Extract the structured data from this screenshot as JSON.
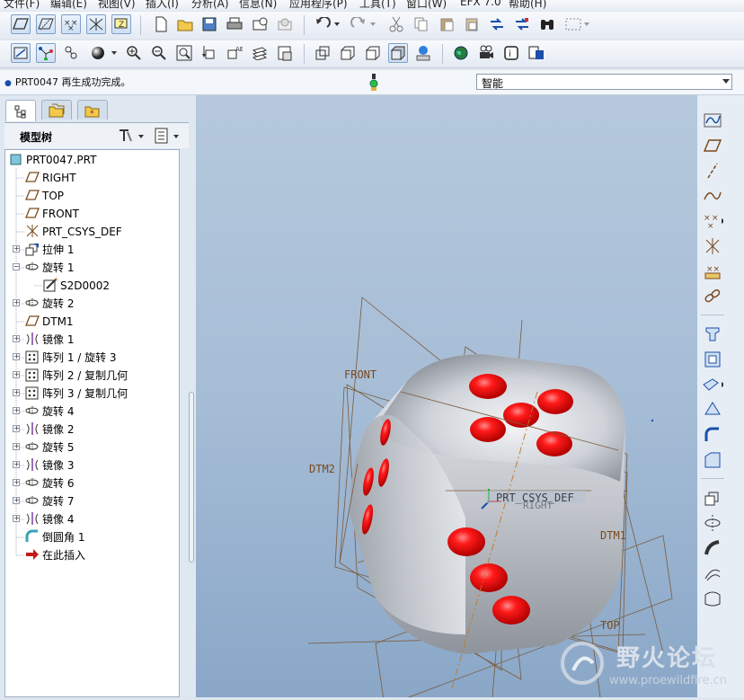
{
  "menu": [
    "文件(F)",
    "编辑(E)",
    "视图(V)",
    "插入(I)",
    "分析(A)",
    "信息(N)",
    "应用程序(P)",
    "工具(T)",
    "窗口(W)",
    "EFX 7.0",
    "帮助(H)"
  ],
  "status": {
    "message": "PRT0047 再生成功完成。",
    "filter_value": "智能"
  },
  "model_tree": {
    "title": "模型树",
    "items": [
      {
        "label": "PRT0047.PRT",
        "icon": "part-icon",
        "level": 0,
        "expander": "",
        "color": "#000"
      },
      {
        "label": "RIGHT",
        "icon": "datum-plane-icon",
        "level": 1,
        "expander": "",
        "color": "#000"
      },
      {
        "label": "TOP",
        "icon": "datum-plane-icon",
        "level": 1,
        "expander": "",
        "color": "#000"
      },
      {
        "label": "FRONT",
        "icon": "datum-plane-icon",
        "level": 1,
        "expander": "",
        "color": "#000"
      },
      {
        "label": "PRT_CSYS_DEF",
        "icon": "csys-icon",
        "level": 1,
        "expander": "",
        "color": "#000"
      },
      {
        "label": "拉伸 1",
        "icon": "extrude-icon",
        "level": 1,
        "expander": "+",
        "color": "#000"
      },
      {
        "label": "旋转 1",
        "icon": "revolve-icon",
        "level": 1,
        "expander": "−",
        "color": "#000"
      },
      {
        "label": "S2D0002",
        "icon": "sketch-icon",
        "level": 2,
        "expander": "",
        "color": "#000"
      },
      {
        "label": "旋转 2",
        "icon": "revolve-icon",
        "level": 1,
        "expander": "+",
        "color": "#000"
      },
      {
        "label": "DTM1",
        "icon": "datum-plane-icon",
        "level": 1,
        "expander": "",
        "color": "#000"
      },
      {
        "label": "镜像 1",
        "icon": "mirror-icon",
        "level": 1,
        "expander": "+",
        "color": "#000"
      },
      {
        "label": "阵列 1 / 旋转 3",
        "icon": "pattern-icon",
        "level": 1,
        "expander": "+",
        "color": "#000"
      },
      {
        "label": "阵列 2 / 复制几何",
        "icon": "pattern-icon",
        "level": 1,
        "expander": "+",
        "color": "#000"
      },
      {
        "label": "阵列 3 / 复制几何",
        "icon": "pattern-icon",
        "level": 1,
        "expander": "+",
        "color": "#000"
      },
      {
        "label": "旋转 4",
        "icon": "revolve-icon",
        "level": 1,
        "expander": "+",
        "color": "#000"
      },
      {
        "label": "镜像 2",
        "icon": "mirror-icon",
        "level": 1,
        "expander": "+",
        "color": "#000"
      },
      {
        "label": "旋转 5",
        "icon": "revolve-icon",
        "level": 1,
        "expander": "+",
        "color": "#000"
      },
      {
        "label": "镜像 3",
        "icon": "mirror-icon",
        "level": 1,
        "expander": "+",
        "color": "#000"
      },
      {
        "label": "旋转 6",
        "icon": "revolve-icon",
        "level": 1,
        "expander": "+",
        "color": "#000"
      },
      {
        "label": "旋转 7",
        "icon": "revolve-icon",
        "level": 1,
        "expander": "+",
        "color": "#000"
      },
      {
        "label": "镜像 4",
        "icon": "mirror-icon",
        "level": 1,
        "expander": "+",
        "color": "#000"
      },
      {
        "label": "倒圆角 1",
        "icon": "round-icon",
        "level": 1,
        "expander": "",
        "color": "#000"
      },
      {
        "label": "在此插入",
        "icon": "insert-here-icon",
        "level": 1,
        "expander": "",
        "color": "#000"
      }
    ]
  },
  "viewport_labels": {
    "front": "FRONT",
    "dtm2": "DTM2",
    "csys": "PRT_CSYS_DEF",
    "right": "RIGHT",
    "dtm1": "DTM1",
    "top": "TOP"
  },
  "watermark": {
    "title": "野火论坛",
    "url": "www.proewildfire.cn"
  },
  "colors": {
    "pip": "#ff1010",
    "datum": "#8b4a1c",
    "die": "#c8ccd2",
    "accent": "#1b4fa8"
  }
}
